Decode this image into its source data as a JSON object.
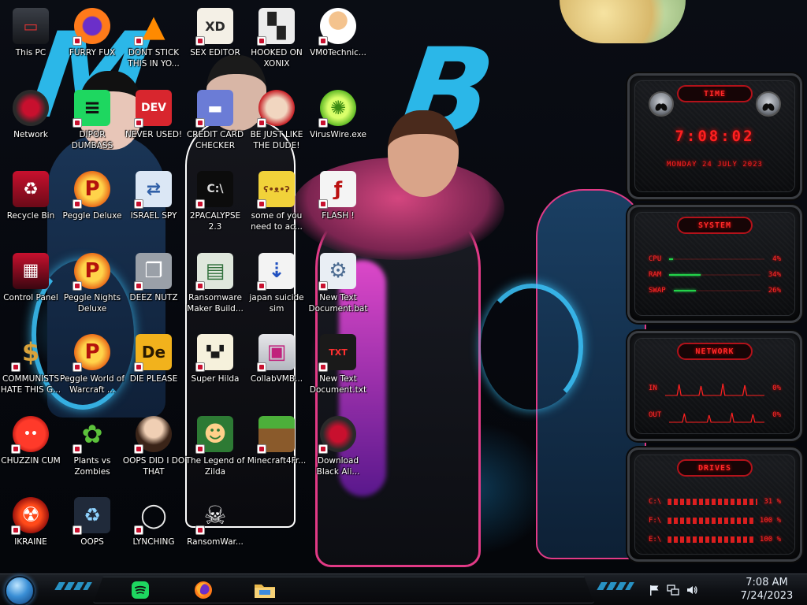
{
  "desktop": {
    "icons": [
      {
        "label": "This PC",
        "icon": "computer-icon"
      },
      {
        "label": "FURRY FUX",
        "icon": "firefox-icon"
      },
      {
        "label": "DONT STICK THIS IN YO...",
        "icon": "vlc-cone-icon"
      },
      {
        "label": "SEX EDITOR",
        "icon": "xd-editor-icon"
      },
      {
        "label": "HOOKED ON XONIX",
        "icon": "xonix-game-icon"
      },
      {
        "label": "VM0Technic...",
        "icon": "doctor-icon"
      },
      {
        "label": "Network",
        "icon": "network-icon"
      },
      {
        "label": "DIPOR DUMBASS",
        "icon": "chat-app-icon"
      },
      {
        "label": "NEVER USED!",
        "icon": "dev-cpp-icon"
      },
      {
        "label": "CREDIT CARD CHECKER",
        "icon": "credit-card-icon"
      },
      {
        "label": "BE JUST LIKE THE DUDE!",
        "icon": "santa-icon"
      },
      {
        "label": "VirusWire.exe",
        "icon": "lime-icon"
      },
      {
        "label": "Recycle Bin",
        "icon": "recycle-bin-icon"
      },
      {
        "label": "Peggle Deluxe",
        "icon": "peggle-icon"
      },
      {
        "label": "ISRAEL SPY",
        "icon": "spy-network-icon"
      },
      {
        "label": "2PACALYPSE 2.3",
        "icon": "terminal-icon"
      },
      {
        "label": "some of you need to ac...",
        "icon": "beaver-icon"
      },
      {
        "label": "FLASH !",
        "icon": "flash-file-icon"
      },
      {
        "label": "Control Panel",
        "icon": "control-panel-icon"
      },
      {
        "label": "Peggle Nights Deluxe",
        "icon": "peggle-nights-icon"
      },
      {
        "label": "DEEZ NUTZ",
        "icon": "window-stack-icon"
      },
      {
        "label": "Ransomware Maker Build...",
        "icon": "program-window-icon"
      },
      {
        "label": "japan suicide sim",
        "icon": "installer-icon"
      },
      {
        "label": "New Text Document.bat",
        "icon": "batch-file-icon"
      },
      {
        "label": "COMMUNISTS HATE THIS G...",
        "icon": "money-bag-icon"
      },
      {
        "label": "Peggle World of Warcraft ...",
        "icon": "peggle-wow-icon"
      },
      {
        "label": "DIE PLEASE",
        "icon": "de-app-icon"
      },
      {
        "label": "Super Hilda",
        "icon": "pixel-cat-icon"
      },
      {
        "label": "CollabVMB...",
        "icon": "collabvm-icon"
      },
      {
        "label": "New Text Document.txt",
        "icon": "text-file-icon"
      },
      {
        "label": "CHUZZIN CUM",
        "icon": "chuzzle-icon"
      },
      {
        "label": "Plants vs Zombies",
        "icon": "plant-icon"
      },
      {
        "label": "OOPS DID I DO THAT",
        "icon": "portrait-icon"
      },
      {
        "label": "The Legend of Zilda",
        "icon": "pixel-hero-icon"
      },
      {
        "label": "Minecraft4Fr...",
        "icon": "minecraft-icon"
      },
      {
        "label": "Download Black Ali...",
        "icon": "alienware-icon"
      },
      {
        "label": "IKRAINE",
        "icon": "radiation-icon"
      },
      {
        "label": "OOPS",
        "icon": "recycle-app-icon"
      },
      {
        "label": "LYNCHING",
        "icon": "rope-icon"
      },
      {
        "label": "RansomWar...",
        "icon": "skull-icon"
      }
    ]
  },
  "widgets": {
    "time": {
      "title": "TIME",
      "clock": "7:08:02",
      "date": "MONDAY 24 JULY 2023"
    },
    "system": {
      "title": "SYSTEM",
      "rows": [
        {
          "label": "CPU",
          "value": "4%",
          "fraction": 0.04
        },
        {
          "label": "RAM",
          "value": "34%",
          "fraction": 0.34
        },
        {
          "label": "SWAP",
          "value": "26%",
          "fraction": 0.26
        }
      ]
    },
    "network": {
      "title": "NETWORK",
      "rows": [
        {
          "label": "IN",
          "value": "0%"
        },
        {
          "label": "OUT",
          "value": "0%"
        }
      ]
    },
    "drives": {
      "title": "DRIVES",
      "rows": [
        {
          "label": "C:\\",
          "value": "31 %"
        },
        {
          "label": "F:\\",
          "value": "100 %"
        },
        {
          "label": "E:\\",
          "value": "100 %"
        }
      ]
    }
  },
  "taskbar": {
    "start_icon": "start-orb-icon",
    "apps": [
      {
        "name": "spotify",
        "icon": "spotify-icon"
      },
      {
        "name": "firefox",
        "icon": "firefox-icon"
      },
      {
        "name": "file-explorer",
        "icon": "folder-icon"
      }
    ],
    "tray": {
      "icons": [
        "flag-icon",
        "network-icon",
        "volume-icon"
      ],
      "time": "7:08 AM",
      "date": "7/24/2023"
    }
  },
  "colors": {
    "widget_accent": "#ff2020",
    "widget_bar": "#23d24a",
    "wallpaper_accent": "#2bb7e8",
    "wallpaper_pink": "#e23a86"
  }
}
